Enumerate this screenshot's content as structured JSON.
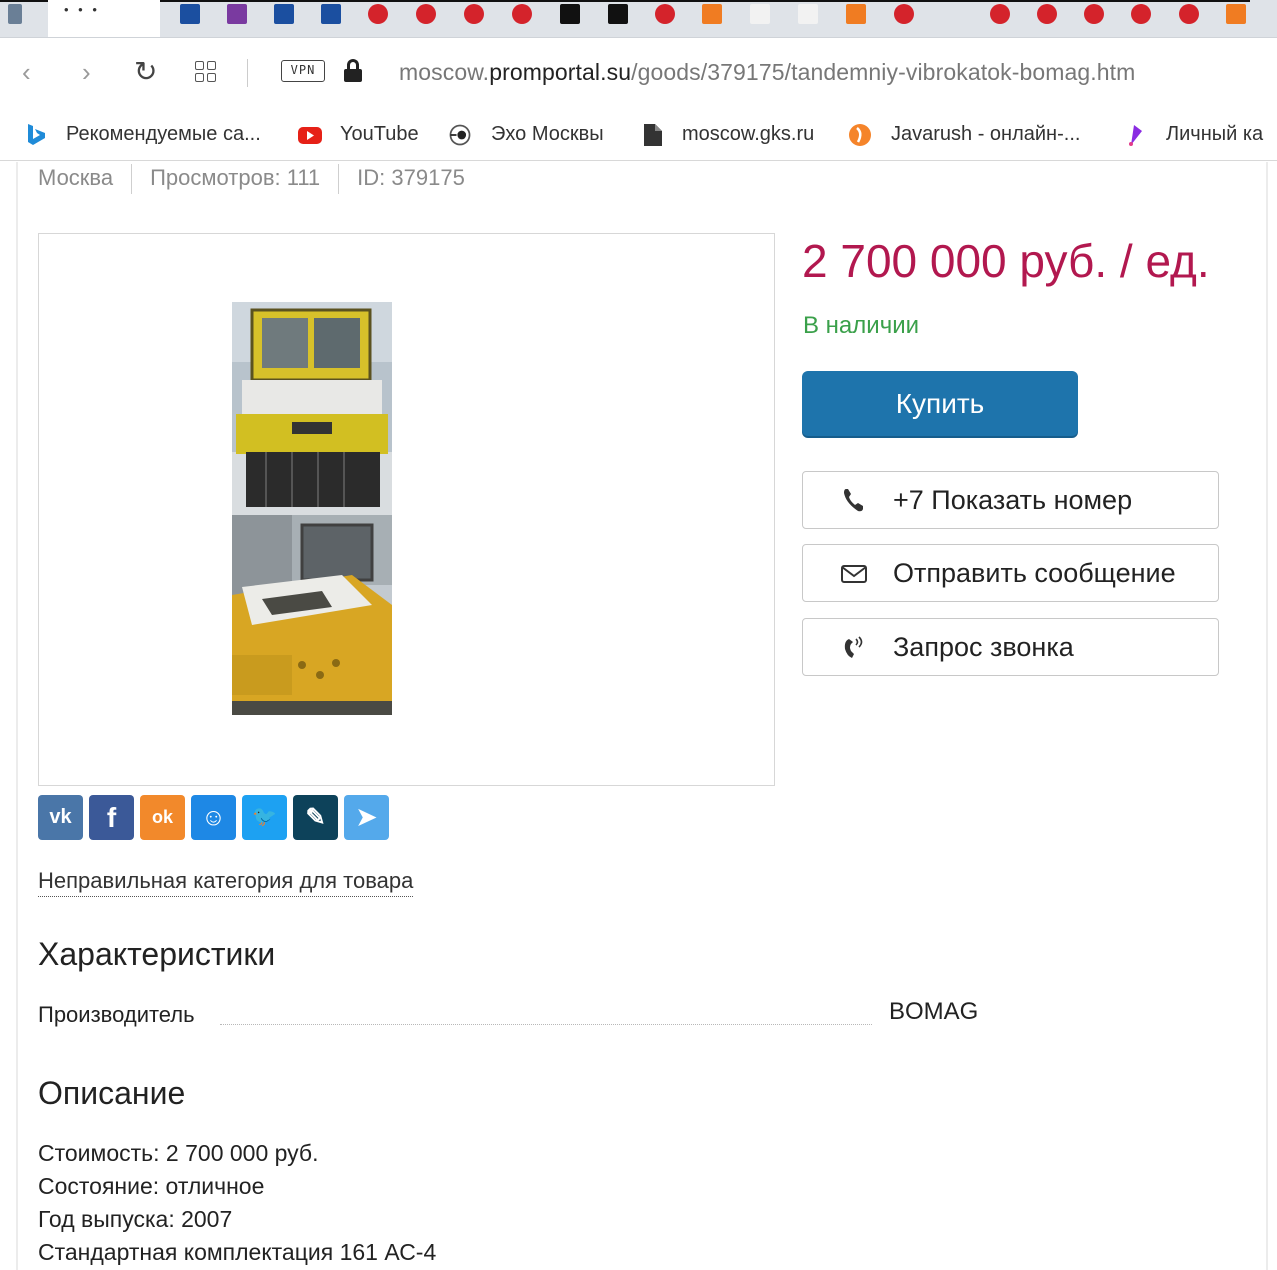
{
  "browser": {
    "back_icon": "chevron-left-icon",
    "forward_icon": "chevron-right-icon",
    "reload_icon": "reload-icon",
    "apps_icon": "apps-grid-icon",
    "vpn_label": "VPN",
    "url": {
      "prefix": "moscow.",
      "host": "promportal.su",
      "path": "/goods/379175/tandemniy-vibrokatok-bomag.htm"
    },
    "bookmarks": [
      {
        "label": "Рекомендуемые са...",
        "icon": "bing-icon"
      },
      {
        "label": "YouTube",
        "icon": "youtube-icon"
      },
      {
        "label": "Эхо Москвы",
        "icon": "echo-icon"
      },
      {
        "label": "moscow.gks.ru",
        "icon": "document-icon"
      },
      {
        "label": "Javarush - онлайн-...",
        "icon": "javarush-icon"
      },
      {
        "label": "Личный ка",
        "icon": "cabinet-icon"
      }
    ]
  },
  "meta": {
    "city": "Москва",
    "views": "Просмотров: 111",
    "id": "ID: 379175"
  },
  "product": {
    "price": "2 700 000 руб. / ед.",
    "stock": "В наличии",
    "buy_label": "Купить",
    "show_phone_label": "+7 Показать номер",
    "send_message_label": "Отправить сообщение",
    "callback_label": "Запрос звонка",
    "colors": {
      "price": "#b2184f",
      "stock": "#3aa04a",
      "buy": "#1e74ac"
    }
  },
  "share": {
    "networks": [
      "vk",
      "facebook",
      "odnoklassniki",
      "moimir",
      "twitter",
      "livejournal",
      "telegram"
    ],
    "glyphs": {
      "vk": "vk",
      "facebook": "f",
      "odnoklassniki": "ok",
      "moimir": "☺",
      "twitter": "🐦",
      "livejournal": "✎",
      "telegram": "➤"
    }
  },
  "wrong_category": "Неправильная категория для товара",
  "specs": {
    "title": "Характеристики",
    "rows": [
      {
        "name": "Производитель",
        "value": "BOMAG"
      }
    ]
  },
  "description": {
    "title": "Описание",
    "lines": [
      "Стоимость: 2 700 000 руб.",
      "Состояние: отличное",
      "Год выпуска: 2007",
      "Стандартная комплектация 161 АС-4"
    ]
  }
}
